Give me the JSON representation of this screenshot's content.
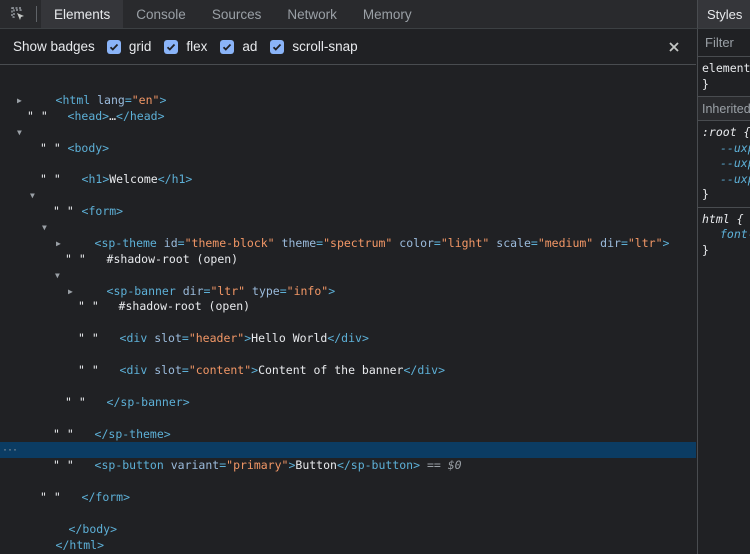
{
  "tabbar": {
    "tabs": [
      "Elements",
      "Console",
      "Sources",
      "Network",
      "Memory"
    ],
    "active_tab": "Elements"
  },
  "badges": {
    "title": "Show badges",
    "options": [
      {
        "label": "grid",
        "checked": true
      },
      {
        "label": "flex",
        "checked": true
      },
      {
        "label": "ad",
        "checked": true
      },
      {
        "label": "scroll-snap",
        "checked": true
      }
    ]
  },
  "tree": {
    "html_open": {
      "tag": "<html",
      "attr": "lang",
      "val": "\"en\"",
      "close": ">"
    },
    "head": {
      "open": "<head>",
      "ellipsis": "…",
      "close": "</head>"
    },
    "ws": "\" \"",
    "body_open": "<body>",
    "h1": {
      "open": "<h1>",
      "text": "Welcome",
      "close": "</h1>"
    },
    "form_open": "<form>",
    "sp_theme": {
      "tag": "<sp-theme",
      "attrs": [
        {
          "name": "id",
          "val": "\"theme-block\""
        },
        {
          "name": "theme",
          "val": "\"spectrum\""
        },
        {
          "name": "color",
          "val": "\"light\""
        },
        {
          "name": "scale",
          "val": "\"medium\""
        },
        {
          "name": "dir",
          "val": "\"ltr\""
        }
      ],
      "close": ">"
    },
    "shadow_root": "#shadow-root (open)",
    "sp_banner": {
      "tag": "<sp-banner",
      "attrs": [
        {
          "name": "dir",
          "val": "\"ltr\""
        },
        {
          "name": "type",
          "val": "\"info\""
        }
      ],
      "close": ">"
    },
    "div_header": {
      "tag": "<div",
      "attr": "slot",
      "val": "\"header\"",
      "text": "Hello World",
      "close": "</div>"
    },
    "div_content": {
      "tag": "<div",
      "attr": "slot",
      "val": "\"content\"",
      "text": "Content of the banner",
      "close": "</div>"
    },
    "sp_banner_close": "</sp-banner>",
    "sp_theme_close": "</sp-theme>",
    "sp_button": {
      "tag": "<sp-button",
      "attr": "variant",
      "val": "\"primary\"",
      "text": "Button",
      "close": "</sp-button>",
      "marker": "== $0"
    },
    "form_close": "</form>",
    "body_close": "</body>",
    "html_close": "</html>",
    "selected_dots": "···"
  },
  "styles_panel": {
    "tab": "Styles",
    "filter_placeholder": "Filter",
    "element_rule": "element",
    "brace_close": "}",
    "inherited": "Inherited",
    "root_rule": ":root {",
    "root_vars": [
      "--uxp",
      "--uxp",
      "--uxp"
    ],
    "html_rule": "html {",
    "html_prop": "font-"
  }
}
